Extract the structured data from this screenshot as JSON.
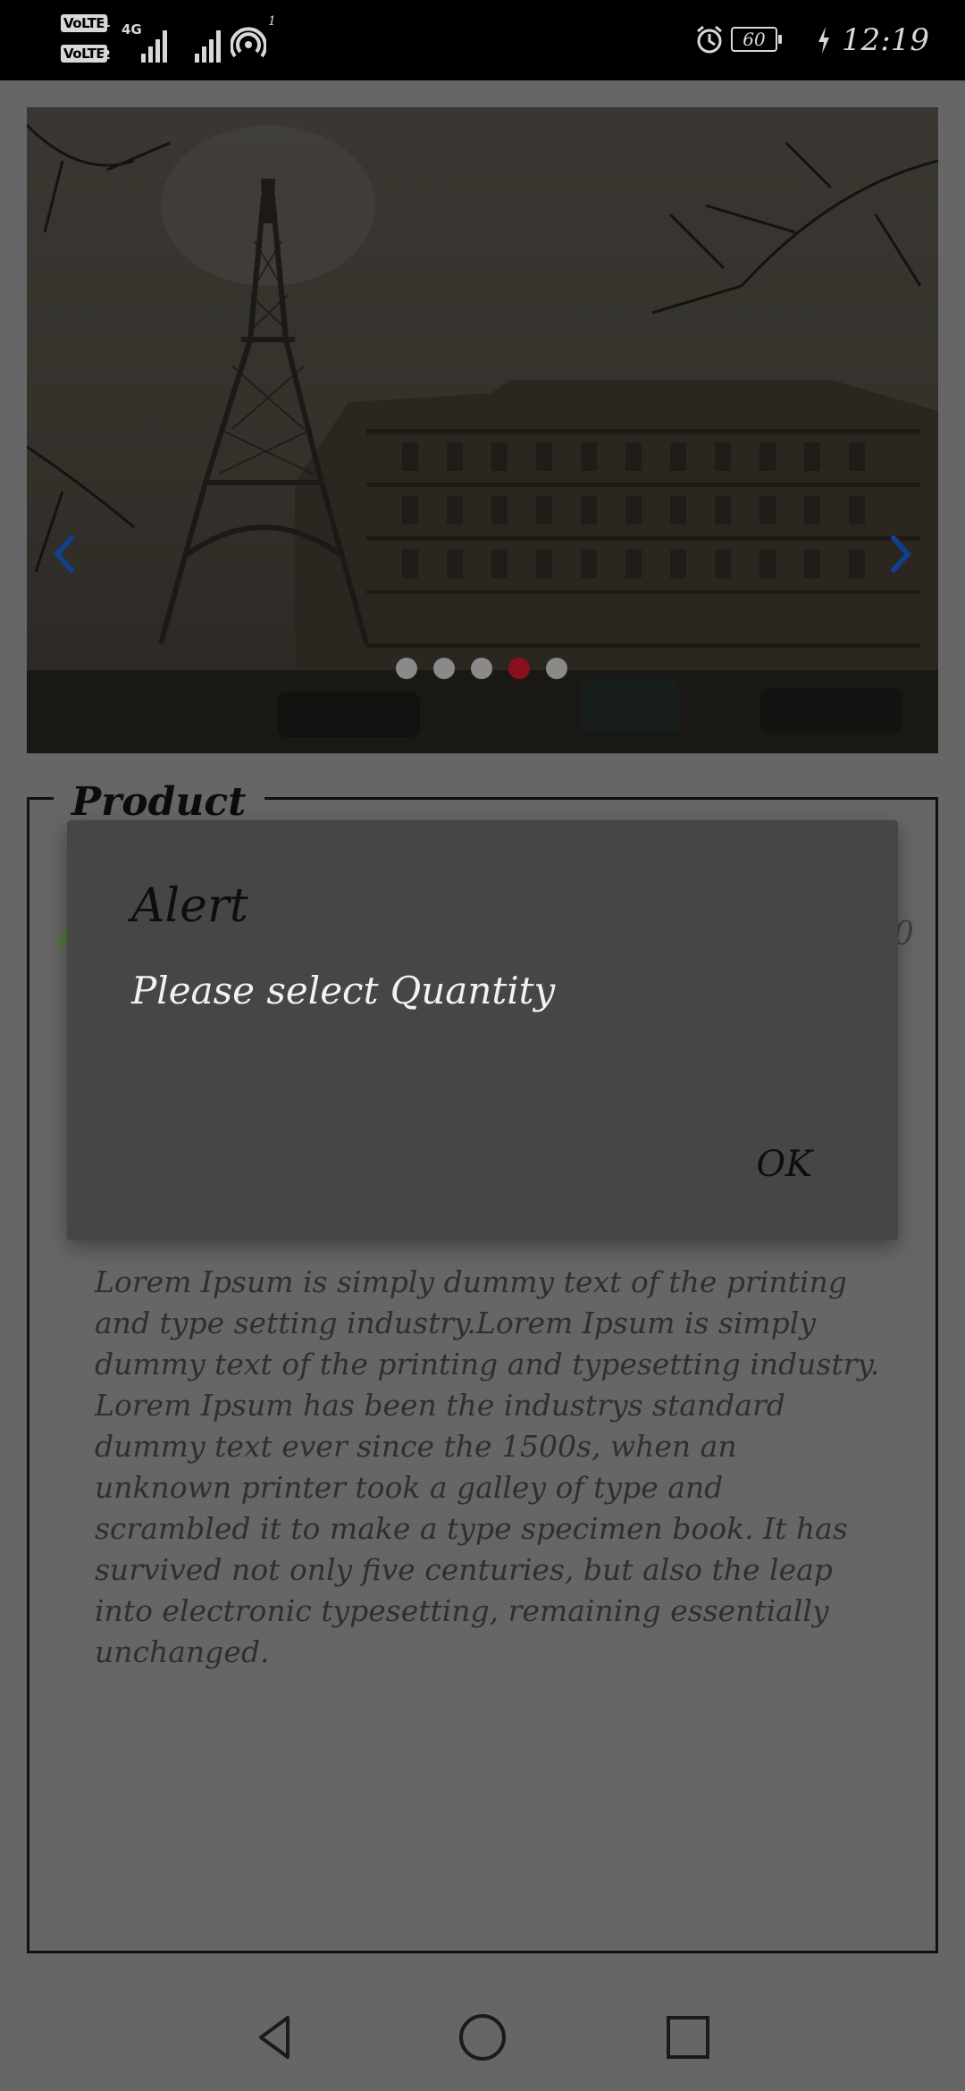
{
  "status_bar": {
    "sim1_label": "VoLTE",
    "sim1_num": "1",
    "sim2_label": "VoLTE",
    "sim2_num": "2",
    "network_type": "4G",
    "hotspot_count": "1",
    "battery_level": "60",
    "time": "12:19"
  },
  "carousel": {
    "slide_count": 5,
    "active_index": 3,
    "active_dot_color": "#8a1020",
    "dot_color": "#8a8a8a",
    "arrow_color": "#123f8a"
  },
  "product": {
    "section_title": "Product",
    "rating_icon": "star-icon",
    "price_fragment": "0",
    "description": " Lorem Ipsum is simply dummy text of the printing and type setting industry.Lorem Ipsum is simply dummy text of the printing and typesetting industry. Lorem Ipsum has been the industrys standard dummy text ever since the 1500s, when an unknown printer took a galley of type and scrambled it to make a type specimen book. It has survived not only five centuries, but also the leap into electronic typesetting, remaining essentially unchanged."
  },
  "dialog": {
    "title": "Alert",
    "message": "Please select Quantity",
    "ok_label": "OK"
  },
  "nav_bar": {
    "back_icon": "back-triangle-icon",
    "home_icon": "home-circle-icon",
    "recents_icon": "recents-square-icon"
  }
}
